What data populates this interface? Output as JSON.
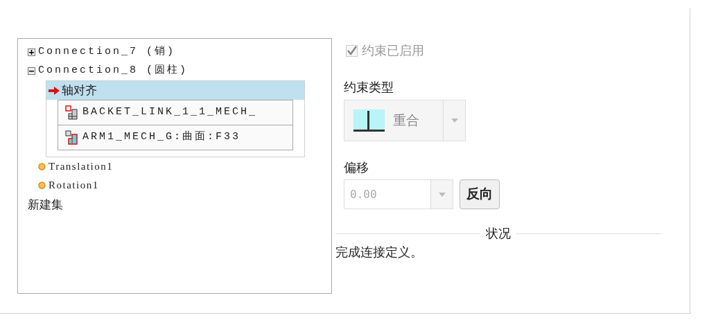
{
  "tree": [
    {
      "kind": "group",
      "label": "Connection_7 (销)",
      "expanded": false
    },
    {
      "kind": "group",
      "label": "Connection_8 (圆柱)",
      "expanded": true,
      "children": [
        {
          "kind": "constraint",
          "label": "轴对齐",
          "selected": true,
          "references": [
            {
              "kind": "part-a",
              "label": "BACKET_LINK_1_1_MECH_"
            },
            {
              "kind": "part-b",
              "label": "ARM1_MECH_G:曲面:F33"
            }
          ]
        },
        {
          "kind": "axis",
          "label": "Translation1",
          "selected": false
        },
        {
          "kind": "axis",
          "label": "Rotation1",
          "selected": false
        }
      ]
    },
    {
      "kind": "action",
      "label": "新建集"
    }
  ],
  "enabled_checkbox": {
    "label": "约束已启用",
    "checked": true,
    "disabled": true
  },
  "constraint_type": {
    "label": "约束类型",
    "value": "重合",
    "disabled": true
  },
  "offset": {
    "label": "偏移",
    "value": "0.00",
    "disabled": true,
    "button": "反向"
  },
  "status": {
    "legend": "状况",
    "message": "完成连接定义。"
  }
}
